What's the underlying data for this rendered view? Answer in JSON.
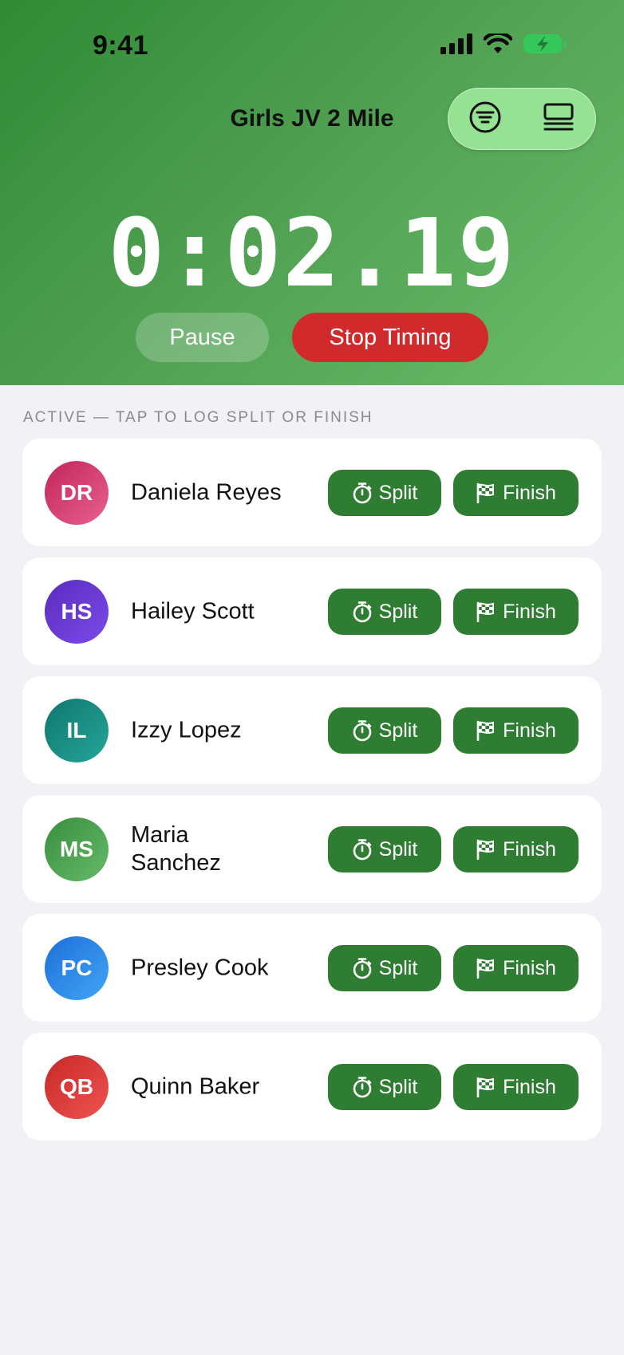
{
  "status_bar": {
    "time": "9:41",
    "icons": [
      "cellular-signal-icon",
      "wifi-icon",
      "battery-charging-icon"
    ],
    "battery_color": "#34c759"
  },
  "nav": {
    "title": "Girls JV 2 Mile",
    "actions": [
      "filter-icon",
      "list-view-icon"
    ]
  },
  "timer": {
    "display": "0:02.19",
    "pause_label": "Pause",
    "stop_label": "Stop Timing"
  },
  "section": {
    "label": "ACTIVE — TAP TO LOG SPLIT OR FINISH"
  },
  "actions": {
    "split_label": "Split",
    "finish_label": "Finish",
    "split_icon": "stopwatch-icon",
    "finish_icon": "checkered-flag-icon"
  },
  "runners": [
    {
      "initials": "DR",
      "name": "Daniela Reyes",
      "color_from": "#c2255c",
      "color_to": "#e8618c"
    },
    {
      "initials": "HS",
      "name": "Hailey Scott",
      "color_from": "#5b2bbf",
      "color_to": "#7a4be8"
    },
    {
      "initials": "IL",
      "name": "Izzy Lopez",
      "color_from": "#0f766e",
      "color_to": "#26a69a"
    },
    {
      "initials": "MS",
      "name": "Maria Sanchez",
      "color_from": "#388e3c",
      "color_to": "#66bb6a"
    },
    {
      "initials": "PC",
      "name": "Presley Cook",
      "color_from": "#1e6fd9",
      "color_to": "#42a5f5"
    },
    {
      "initials": "QB",
      "name": "Quinn Baker",
      "color_from": "#c62828",
      "color_to": "#ef5350"
    }
  ],
  "colors": {
    "accent_green": "#2e7d32",
    "stop_red": "#d12a2c",
    "background": "#f1f1f6"
  }
}
